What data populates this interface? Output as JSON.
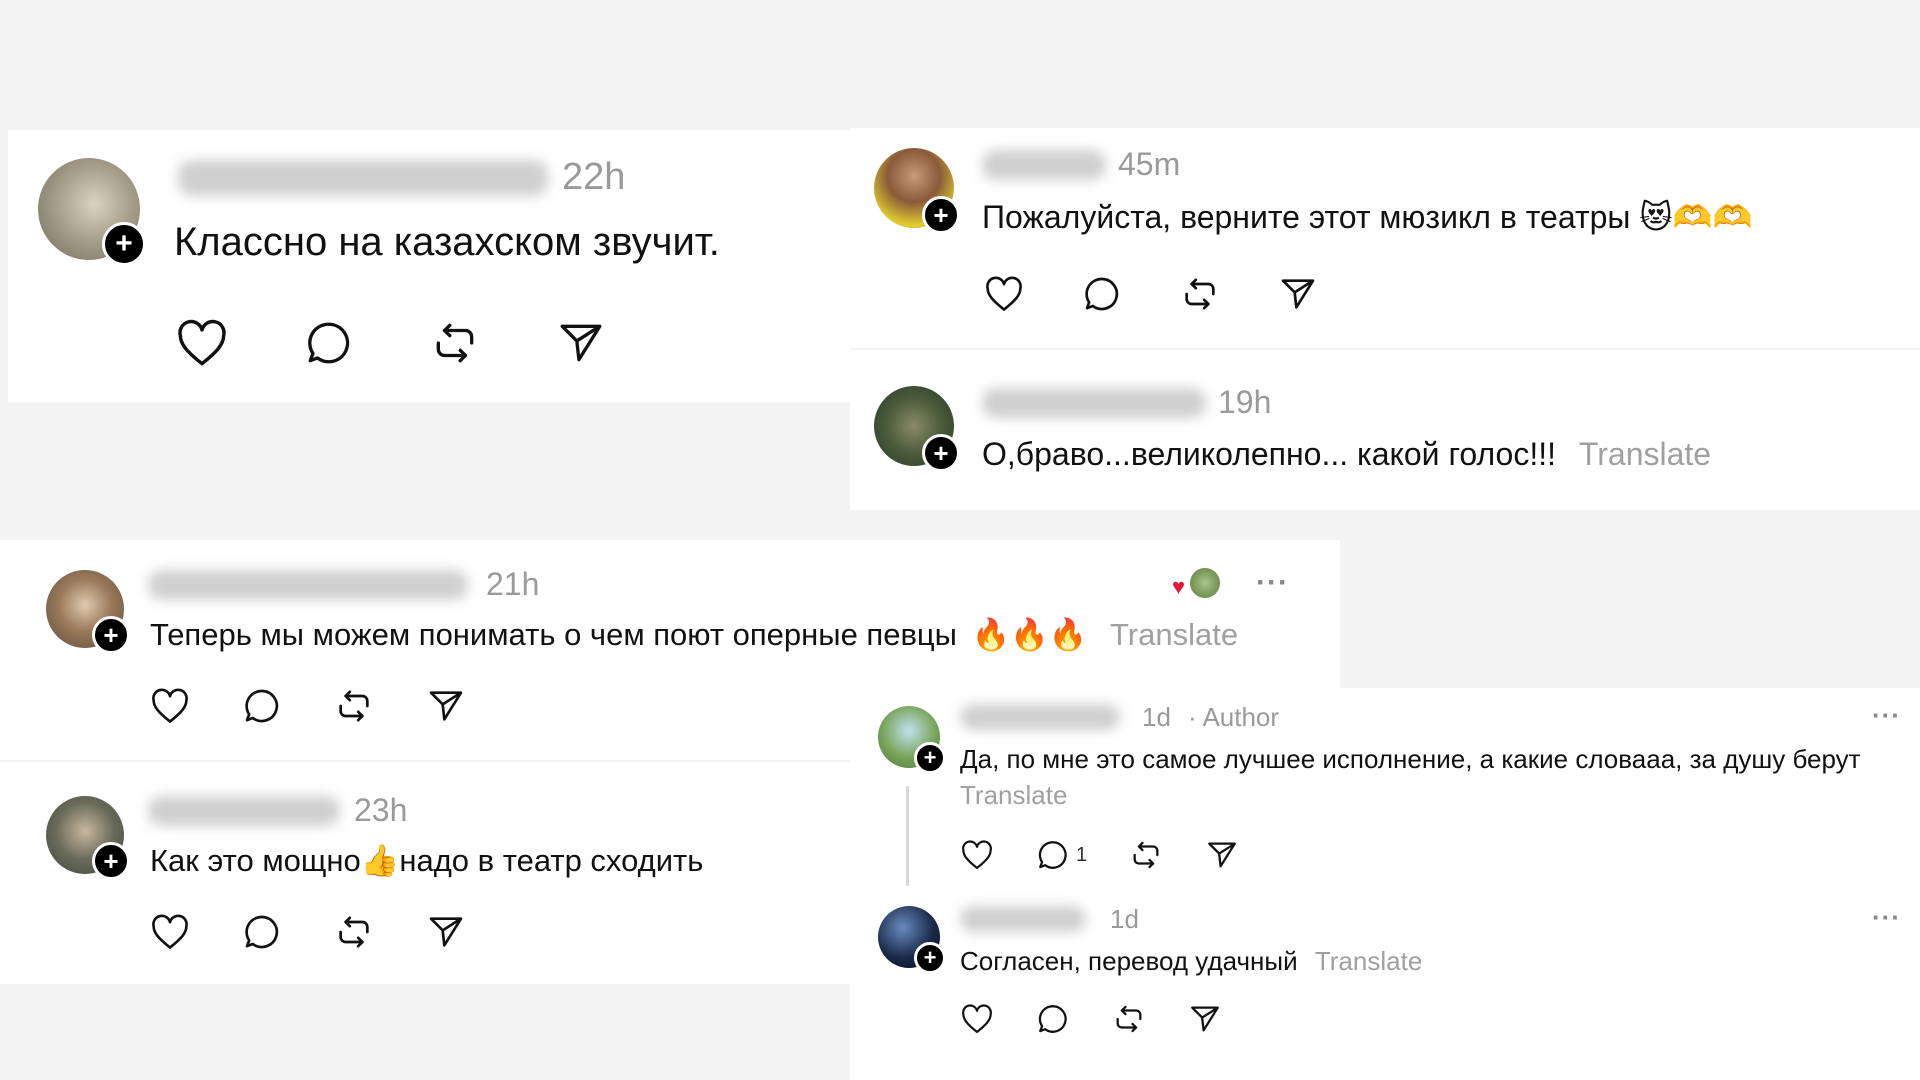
{
  "comments": [
    {
      "time": "22h",
      "text": "Классно на казахском звучит.",
      "avatar_color": "#8d8a7a"
    },
    {
      "time": "45m",
      "text": "Пожалуйста, верните этот мюзикл в театры",
      "emoji": "😻🫶🫶",
      "avatar_color": "#d6c23a"
    },
    {
      "time": "19h",
      "text": "О,браво...великолепно... какой голос!!!",
      "translate": "Translate",
      "avatar_color": "#4a5a3a"
    },
    {
      "time": "21h",
      "text": "Теперь мы можем понимать о чем поют оперные певцы",
      "emoji": "🔥🔥🔥",
      "translate": "Translate",
      "more": "···",
      "avatar_color": "#9a7a5a"
    },
    {
      "time": "23h",
      "text": "Как это мощно",
      "emoji": "👍",
      "text_after": "надо в театр сходить",
      "avatar_color": "#6a6a5a"
    },
    {
      "time": "1d",
      "author_label": "· Author",
      "text": "Да, по мне это самое лучшее исполнение, а какие словааа, за душу берут",
      "translate": "Translate",
      "reply_count": "1",
      "more": "···",
      "avatar_color": "#7aa35a"
    },
    {
      "time": "1d",
      "text": "Согласен, перевод удачный",
      "translate": "Translate",
      "more": "···",
      "avatar_color": "#1a2a4a"
    }
  ],
  "icons": {
    "like": "heart-icon",
    "reply": "comment-bubble-icon",
    "repost": "repost-icon",
    "share": "send-icon",
    "follow": "plus-icon"
  }
}
